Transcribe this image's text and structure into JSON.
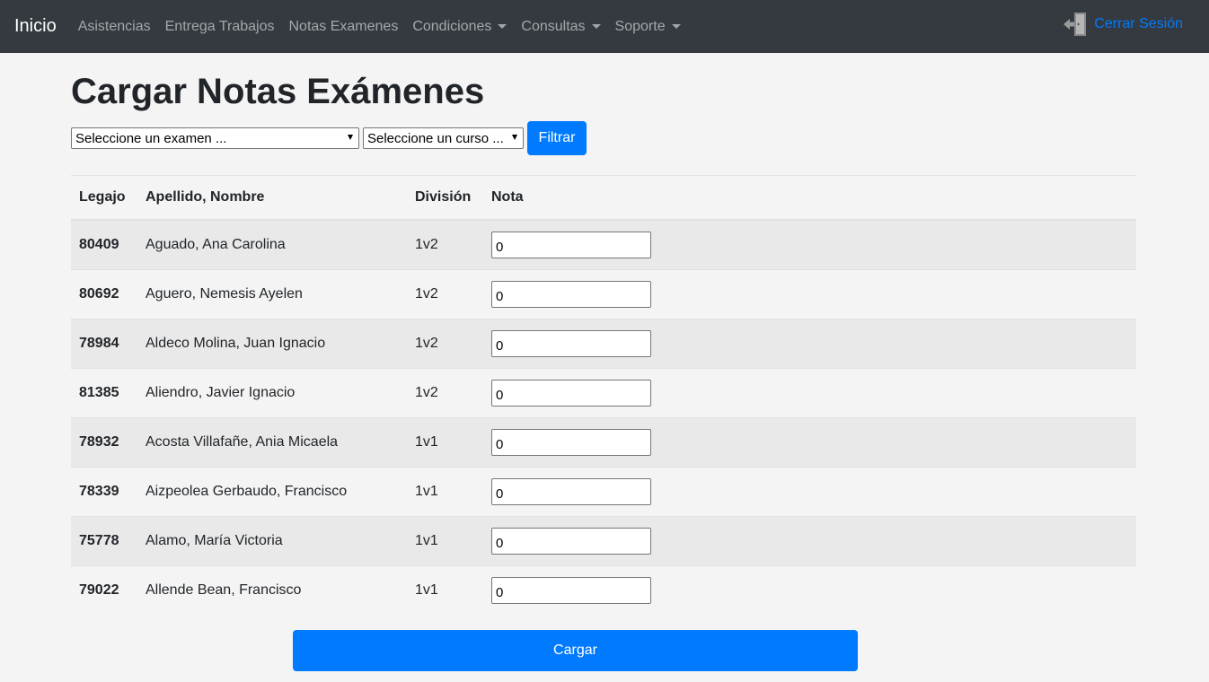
{
  "nav": {
    "brand": "Inicio",
    "links": [
      {
        "label": "Asistencias",
        "dropdown": false
      },
      {
        "label": "Entrega Trabajos",
        "dropdown": false
      },
      {
        "label": "Notas Examenes",
        "dropdown": false
      },
      {
        "label": "Condiciones",
        "dropdown": true
      },
      {
        "label": "Consultas",
        "dropdown": true
      },
      {
        "label": "Soporte",
        "dropdown": true
      }
    ],
    "logout_label": "Cerrar Sesión"
  },
  "page": {
    "title": "Cargar Notas Exámenes"
  },
  "filters": {
    "exam_select": "Seleccione un examen ...",
    "course_select": "Seleccione un curso ...",
    "filter_button": "Filtrar"
  },
  "table": {
    "headers": {
      "legajo": "Legajo",
      "nombre": "Apellido, Nombre",
      "division": "División",
      "nota": "Nota"
    },
    "rows": [
      {
        "legajo": "80409",
        "nombre": "Aguado, Ana Carolina",
        "division": "1v2",
        "nota": "0"
      },
      {
        "legajo": "80692",
        "nombre": "Aguero, Nemesis Ayelen",
        "division": "1v2",
        "nota": "0"
      },
      {
        "legajo": "78984",
        "nombre": "Aldeco Molina, Juan Ignacio",
        "division": "1v2",
        "nota": "0"
      },
      {
        "legajo": "81385",
        "nombre": "Aliendro, Javier Ignacio",
        "division": "1v2",
        "nota": "0"
      },
      {
        "legajo": "78932",
        "nombre": "Acosta Villafañe, Ania Micaela",
        "division": "1v1",
        "nota": "0"
      },
      {
        "legajo": "78339",
        "nombre": "Aizpeolea Gerbaudo, Francisco",
        "division": "1v1",
        "nota": "0"
      },
      {
        "legajo": "75778",
        "nombre": "Alamo, María Victoria",
        "division": "1v1",
        "nota": "0"
      },
      {
        "legajo": "79022",
        "nombre": "Allende Bean, Francisco",
        "division": "1v1",
        "nota": "0"
      }
    ]
  },
  "submit": {
    "label": "Cargar"
  },
  "colors": {
    "navbar": "#343a40",
    "primary": "#007bff",
    "background": "#f4f4f4"
  }
}
